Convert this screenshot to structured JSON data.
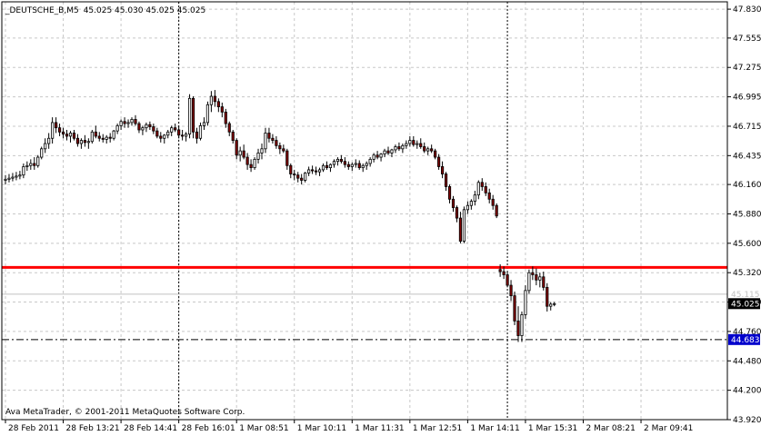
{
  "header": {
    "symbol": "_DEUTSCHE_B,M5",
    "ohlc": "45.025 45.030 45.025 45.025"
  },
  "footer": {
    "copyright": "Ava MetaTrader, © 2001-2011 MetaQuotes Software Corp."
  },
  "chart_data": {
    "type": "candlestick",
    "ylim": [
      43.92,
      47.9
    ],
    "y_ticks": [
      47.83,
      47.555,
      47.275,
      46.995,
      46.715,
      46.435,
      46.16,
      45.88,
      45.6,
      45.32,
      45.04,
      44.76,
      44.48,
      44.2,
      43.92
    ],
    "y_tick_labels": [
      "47.830",
      "47.555",
      "47.275",
      "46.995",
      "46.715",
      "46.435",
      "46.160",
      "45.880",
      "45.600",
      "45.320",
      "45.040",
      "44.760",
      "44.480",
      "44.200",
      "43.920"
    ],
    "x_ticks": [
      {
        "label": "28 Feb 2011",
        "bar": 0
      },
      {
        "label": "28 Feb 13:21",
        "bar": 16
      },
      {
        "label": "28 Feb 14:41",
        "bar": 32
      },
      {
        "label": "28 Feb 16:01",
        "bar": 48
      },
      {
        "label": "1 Mar 08:51",
        "bar": 64
      },
      {
        "label": "1 Mar 10:11",
        "bar": 80
      },
      {
        "label": "1 Mar 11:31",
        "bar": 96
      },
      {
        "label": "1 Mar 12:51",
        "bar": 112
      },
      {
        "label": "1 Mar 14:11",
        "bar": 128
      },
      {
        "label": "1 Mar 15:31",
        "bar": 144
      },
      {
        "label": "2 Mar 08:21",
        "bar": 160
      },
      {
        "label": "2 Mar 09:41",
        "bar": 176
      }
    ],
    "grid": true,
    "grid_style": "dashed",
    "bar_count": 178,
    "candles": [
      [
        46.2,
        46.25,
        46.16,
        46.21
      ],
      [
        46.21,
        46.26,
        46.18,
        46.22
      ],
      [
        46.22,
        46.27,
        46.19,
        46.23
      ],
      [
        46.23,
        46.28,
        46.2,
        46.24
      ],
      [
        46.24,
        46.29,
        46.21,
        46.25
      ],
      [
        46.25,
        46.36,
        46.22,
        46.33
      ],
      [
        46.33,
        46.38,
        46.29,
        46.34
      ],
      [
        46.34,
        46.4,
        46.3,
        46.36
      ],
      [
        46.36,
        46.42,
        46.3,
        46.34
      ],
      [
        46.34,
        46.44,
        46.32,
        46.42
      ],
      [
        46.42,
        46.52,
        46.4,
        46.5
      ],
      [
        46.5,
        46.6,
        46.46,
        46.55
      ],
      [
        46.55,
        46.65,
        46.5,
        46.6
      ],
      [
        46.6,
        46.8,
        46.55,
        46.75
      ],
      [
        46.75,
        46.8,
        46.65,
        46.7
      ],
      [
        46.7,
        46.74,
        46.62,
        46.66
      ],
      [
        46.66,
        46.7,
        46.6,
        46.64
      ],
      [
        46.64,
        46.68,
        46.58,
        46.62
      ],
      [
        46.62,
        46.67,
        46.56,
        46.65
      ],
      [
        46.65,
        46.68,
        46.58,
        46.6
      ],
      [
        46.6,
        46.64,
        46.52,
        46.55
      ],
      [
        46.55,
        46.6,
        46.5,
        46.58
      ],
      [
        46.58,
        46.63,
        46.52,
        46.56
      ],
      [
        46.56,
        46.6,
        46.5,
        46.57
      ],
      [
        46.57,
        46.68,
        46.55,
        46.66
      ],
      [
        46.66,
        46.72,
        46.6,
        46.62
      ],
      [
        46.62,
        46.66,
        46.57,
        46.6
      ],
      [
        46.6,
        46.64,
        46.56,
        46.59
      ],
      [
        46.59,
        46.63,
        46.55,
        46.61
      ],
      [
        46.61,
        46.65,
        46.56,
        46.6
      ],
      [
        46.6,
        46.68,
        46.58,
        46.67
      ],
      [
        46.67,
        46.74,
        46.64,
        46.72
      ],
      [
        46.72,
        46.78,
        46.68,
        46.76
      ],
      [
        46.76,
        46.8,
        46.7,
        46.74
      ],
      [
        46.74,
        46.78,
        46.7,
        46.75
      ],
      [
        46.75,
        46.8,
        46.72,
        46.78
      ],
      [
        46.78,
        46.82,
        46.72,
        46.74
      ],
      [
        46.74,
        46.76,
        46.65,
        46.68
      ],
      [
        46.68,
        46.72,
        46.63,
        46.7
      ],
      [
        46.7,
        46.75,
        46.66,
        46.73
      ],
      [
        46.73,
        46.76,
        46.68,
        46.71
      ],
      [
        46.71,
        46.74,
        46.64,
        46.67
      ],
      [
        46.67,
        46.7,
        46.6,
        46.62
      ],
      [
        46.62,
        46.66,
        46.56,
        46.6
      ],
      [
        46.6,
        46.64,
        46.55,
        46.63
      ],
      [
        46.63,
        46.68,
        46.6,
        46.66
      ],
      [
        46.66,
        46.72,
        46.62,
        46.7
      ],
      [
        46.7,
        46.74,
        46.66,
        46.68
      ],
      [
        46.68,
        46.72,
        46.6,
        46.63
      ],
      [
        46.63,
        46.68,
        46.58,
        46.62
      ],
      [
        46.62,
        46.66,
        46.57,
        46.64
      ],
      [
        46.64,
        47.02,
        46.6,
        46.98
      ],
      [
        46.98,
        47.0,
        46.6,
        46.66
      ],
      [
        46.66,
        46.7,
        46.55,
        46.6
      ],
      [
        46.6,
        46.75,
        46.58,
        46.72
      ],
      [
        46.72,
        46.8,
        46.68,
        46.75
      ],
      [
        46.75,
        46.95,
        46.72,
        46.92
      ],
      [
        46.92,
        47.05,
        46.85,
        47.0
      ],
      [
        47.0,
        47.06,
        46.9,
        46.95
      ],
      [
        46.95,
        46.98,
        46.85,
        46.9
      ],
      [
        46.9,
        46.94,
        46.8,
        46.85
      ],
      [
        46.85,
        46.88,
        46.7,
        46.74
      ],
      [
        46.74,
        46.76,
        46.62,
        46.66
      ],
      [
        46.66,
        46.68,
        46.55,
        46.58
      ],
      [
        46.58,
        46.6,
        46.4,
        46.44
      ],
      [
        46.44,
        46.52,
        46.38,
        46.48
      ],
      [
        46.48,
        46.54,
        46.4,
        46.42
      ],
      [
        46.42,
        46.46,
        46.3,
        46.35
      ],
      [
        46.35,
        46.4,
        46.28,
        46.32
      ],
      [
        46.32,
        46.42,
        46.3,
        46.4
      ],
      [
        46.4,
        46.5,
        46.36,
        46.46
      ],
      [
        46.46,
        46.55,
        46.4,
        46.5
      ],
      [
        46.5,
        46.7,
        46.46,
        46.65
      ],
      [
        46.65,
        46.7,
        46.56,
        46.6
      ],
      [
        46.6,
        46.64,
        46.55,
        46.58
      ],
      [
        46.58,
        46.62,
        46.5,
        46.53
      ],
      [
        46.53,
        46.56,
        46.45,
        46.5
      ],
      [
        46.5,
        46.54,
        46.46,
        46.48
      ],
      [
        46.48,
        46.5,
        46.3,
        46.34
      ],
      [
        46.34,
        46.36,
        46.22,
        46.26
      ],
      [
        46.26,
        46.3,
        46.2,
        46.25
      ],
      [
        46.25,
        46.28,
        46.18,
        46.22
      ],
      [
        46.22,
        46.26,
        46.16,
        46.2
      ],
      [
        46.2,
        46.28,
        46.18,
        46.27
      ],
      [
        46.27,
        46.33,
        46.24,
        46.3
      ],
      [
        46.3,
        46.34,
        46.26,
        46.29
      ],
      [
        46.29,
        46.33,
        46.25,
        46.28
      ],
      [
        46.28,
        46.32,
        46.24,
        46.3
      ],
      [
        46.3,
        46.36,
        46.28,
        46.34
      ],
      [
        46.34,
        46.38,
        46.3,
        46.32
      ],
      [
        46.32,
        46.36,
        46.28,
        46.35
      ],
      [
        46.35,
        46.4,
        46.32,
        46.38
      ],
      [
        46.38,
        46.42,
        46.34,
        46.4
      ],
      [
        46.4,
        46.44,
        46.36,
        46.38
      ],
      [
        46.38,
        46.42,
        46.32,
        46.35
      ],
      [
        46.35,
        46.38,
        46.3,
        46.33
      ],
      [
        46.33,
        46.37,
        46.29,
        46.35
      ],
      [
        46.35,
        46.4,
        46.32,
        46.36
      ],
      [
        46.36,
        46.39,
        46.3,
        46.32
      ],
      [
        46.32,
        46.36,
        46.28,
        46.34
      ],
      [
        46.34,
        46.38,
        46.3,
        46.36
      ],
      [
        46.36,
        46.42,
        46.33,
        46.4
      ],
      [
        46.4,
        46.46,
        46.37,
        46.44
      ],
      [
        46.44,
        46.48,
        46.4,
        46.42
      ],
      [
        46.42,
        46.46,
        46.38,
        46.45
      ],
      [
        46.45,
        46.5,
        46.42,
        46.48
      ],
      [
        46.48,
        46.52,
        46.44,
        46.46
      ],
      [
        46.46,
        46.5,
        46.42,
        46.49
      ],
      [
        46.49,
        46.54,
        46.46,
        46.52
      ],
      [
        46.52,
        46.56,
        46.48,
        46.5
      ],
      [
        46.5,
        46.55,
        46.46,
        46.53
      ],
      [
        46.53,
        46.58,
        46.5,
        46.55
      ],
      [
        46.55,
        46.62,
        46.52,
        46.58
      ],
      [
        46.58,
        46.62,
        46.52,
        46.54
      ],
      [
        46.54,
        46.58,
        46.5,
        46.55
      ],
      [
        46.55,
        46.6,
        46.5,
        46.52
      ],
      [
        46.52,
        46.56,
        46.46,
        46.48
      ],
      [
        46.48,
        46.52,
        46.44,
        46.5
      ],
      [
        46.5,
        46.54,
        46.46,
        46.48
      ],
      [
        46.48,
        46.5,
        46.4,
        46.42
      ],
      [
        46.42,
        46.45,
        46.3,
        46.33
      ],
      [
        46.33,
        46.38,
        46.22,
        46.26
      ],
      [
        46.26,
        46.28,
        46.1,
        46.14
      ],
      [
        46.14,
        46.16,
        45.98,
        46.02
      ],
      [
        46.02,
        46.05,
        45.9,
        45.94
      ],
      [
        45.94,
        45.96,
        45.8,
        45.84
      ],
      [
        45.84,
        45.9,
        45.6,
        45.62
      ],
      [
        45.62,
        45.95,
        45.6,
        45.92
      ],
      [
        45.92,
        46.0,
        45.88,
        45.96
      ],
      [
        45.96,
        46.02,
        45.92,
        46.0
      ],
      [
        46.0,
        46.1,
        45.96,
        46.06
      ],
      [
        46.06,
        46.2,
        46.02,
        46.18
      ],
      [
        46.18,
        46.22,
        46.1,
        46.14
      ],
      [
        46.14,
        46.18,
        46.05,
        46.08
      ],
      [
        46.08,
        46.12,
        45.98,
        46.02
      ],
      [
        46.02,
        46.06,
        45.92,
        45.96
      ],
      [
        45.96,
        45.98,
        45.84,
        45.86
      ],
      [
        45.35,
        45.4,
        45.28,
        45.33
      ],
      [
        45.33,
        45.38,
        45.26,
        45.3
      ],
      [
        45.3,
        45.33,
        45.18,
        45.2
      ],
      [
        45.2,
        45.25,
        45.05,
        45.1
      ],
      [
        45.1,
        45.14,
        44.82,
        44.86
      ],
      [
        44.86,
        45.0,
        44.66,
        44.72
      ],
      [
        44.72,
        44.95,
        44.66,
        44.92
      ],
      [
        44.92,
        45.2,
        44.88,
        45.15
      ],
      [
        45.15,
        45.35,
        45.12,
        45.32
      ],
      [
        45.32,
        45.38,
        45.25,
        45.3
      ],
      [
        45.3,
        45.36,
        45.2,
        45.25
      ],
      [
        45.25,
        45.32,
        45.18,
        45.28
      ],
      [
        45.28,
        45.33,
        45.15,
        45.18
      ],
      [
        45.18,
        45.22,
        44.95,
        45.0
      ],
      [
        45.0,
        45.04,
        44.96,
        45.02
      ],
      [
        45.02,
        45.04,
        45.0,
        45.025
      ]
    ],
    "horizontal_lines": [
      {
        "price": 45.37,
        "color": "#ff0000",
        "style": "solid"
      },
      {
        "price": 45.115,
        "color": "#c0c0c0",
        "style": "solid"
      },
      {
        "price": 44.683,
        "color": "#000000",
        "style": "dash-dot"
      }
    ],
    "vertical_lines": [
      {
        "bar": 48,
        "style": "dotted"
      },
      {
        "bar": 139,
        "style": "dotted"
      }
    ],
    "price_labels": [
      {
        "label": "45.115",
        "price": 45.115,
        "bg": "#ffffff",
        "fg": "#c0c0c0"
      },
      {
        "label": "45.025",
        "price": 45.025,
        "bg": "#000000",
        "fg": "#ffffff"
      },
      {
        "label": "44.683",
        "price": 44.683,
        "bg": "#0000cc",
        "fg": "#ffffff"
      }
    ],
    "colors": {
      "bull_body": "#ffffff",
      "bear_body": "#800000",
      "wick": "#000000",
      "grid": "#c8c8c8",
      "frame": "#000000"
    }
  }
}
